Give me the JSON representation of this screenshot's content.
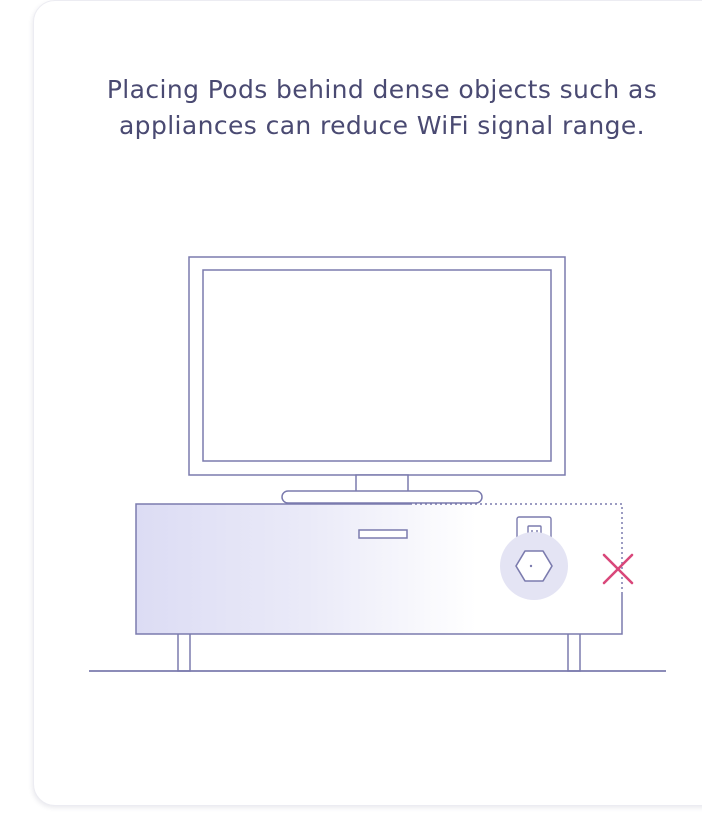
{
  "tip_card": {
    "message": "Placing Pods behind dense objects such as appliances can reduce WiFi signal range."
  },
  "illustration": {
    "icons": [
      "tv-icon",
      "tv-stand-icon",
      "wall-outlet-icon",
      "pod-icon",
      "x-mark-icon"
    ],
    "colors": {
      "line": "#7b7bae",
      "stand_fill_start": "#dcdcf4",
      "pod_glow": "#e4e4f4",
      "warning_mark": "#d9477a",
      "text": "#4a4a72"
    }
  }
}
